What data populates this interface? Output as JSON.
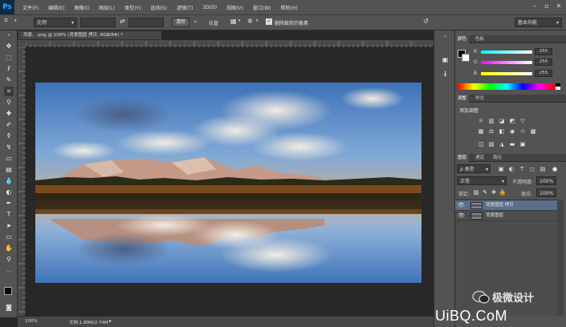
{
  "app": {
    "logo": "Ps"
  },
  "menu": [
    "文件(F)",
    "编辑(E)",
    "图像(I)",
    "图层(L)",
    "类型(Y)",
    "选择(S)",
    "滤镜(T)",
    "3D(D)",
    "视图(V)",
    "窗口(W)",
    "帮助(H)"
  ],
  "options": {
    "ratio_value": "比例",
    "swap_icon": "⇄",
    "clear_label": "清除",
    "straighten_label": "拉直",
    "delete_cropped_label": "删除裁剪的像素",
    "delete_cropped_checked": true,
    "workspace": "基本功能"
  },
  "document": {
    "tab_title": "风景、.png @ 100% (背景图层 拷贝, RGB/8#) *",
    "zoom": "100%",
    "doc_info": "文档:1.89M/2.74M"
  },
  "color_panel": {
    "tabs": [
      "颜色",
      "色板"
    ],
    "channels": [
      {
        "label": "R",
        "value": "255",
        "color": "#ff00ff"
      },
      {
        "label": "G",
        "value": "255",
        "color": "#00ffff"
      },
      {
        "label": "B",
        "value": "255",
        "color": "#ffff00"
      }
    ]
  },
  "adjustments_panel": {
    "tabs": [
      "调整",
      "样式"
    ],
    "title": "添加调整"
  },
  "layers_panel": {
    "tabs": [
      "图层",
      "通道",
      "路径"
    ],
    "kind_filter": "ρ 类型",
    "blend_mode": "正常",
    "opacity_label": "不透明度:",
    "opacity_value": "100%",
    "lock_label": "锁定:",
    "fill_label": "填充:",
    "fill_value": "100%",
    "layers": [
      {
        "name": "背景图层 拷贝",
        "selected": true
      },
      {
        "name": "背景图层",
        "selected": false
      }
    ]
  },
  "watermark": {
    "line1": "极微设计",
    "line2": "UiBQ.CoM"
  }
}
